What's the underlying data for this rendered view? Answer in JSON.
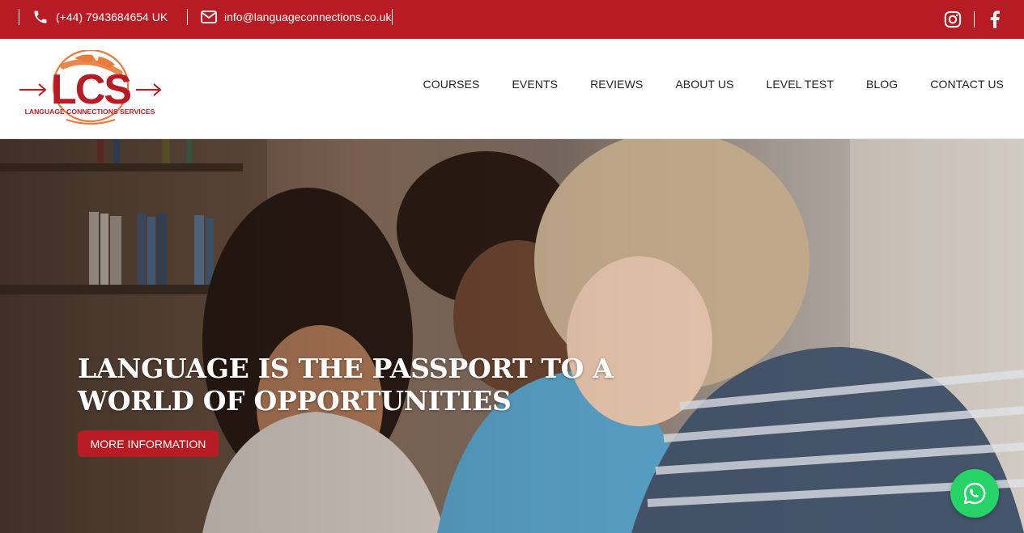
{
  "topbar": {
    "phone": "(+44) 7943684654 UK",
    "email": "info@languageconnections.co.uk",
    "social": [
      {
        "icon": "instagram-icon"
      },
      {
        "icon": "facebook-icon"
      }
    ]
  },
  "logo": {
    "letters": "LCS",
    "tagline": "LANGUAGE CONNECTIONS SERVICES"
  },
  "nav": {
    "items": [
      "COURSES",
      "EVENTS",
      "REVIEWS",
      "ABOUT US",
      "LEVEL TEST",
      "BLOG",
      "CONTACT US"
    ]
  },
  "hero": {
    "title_line1": "LANGUAGE IS THE PASSPORT TO A",
    "title_line2": "WORLD OF OPPORTUNITIES",
    "button": "MORE INFORMATION"
  },
  "floating": {
    "whatsapp_icon": "whatsapp-icon"
  },
  "colors": {
    "brand_red": "#b71b23",
    "logo_orange": "#e87a3a",
    "whatsapp_green": "#25d366"
  }
}
